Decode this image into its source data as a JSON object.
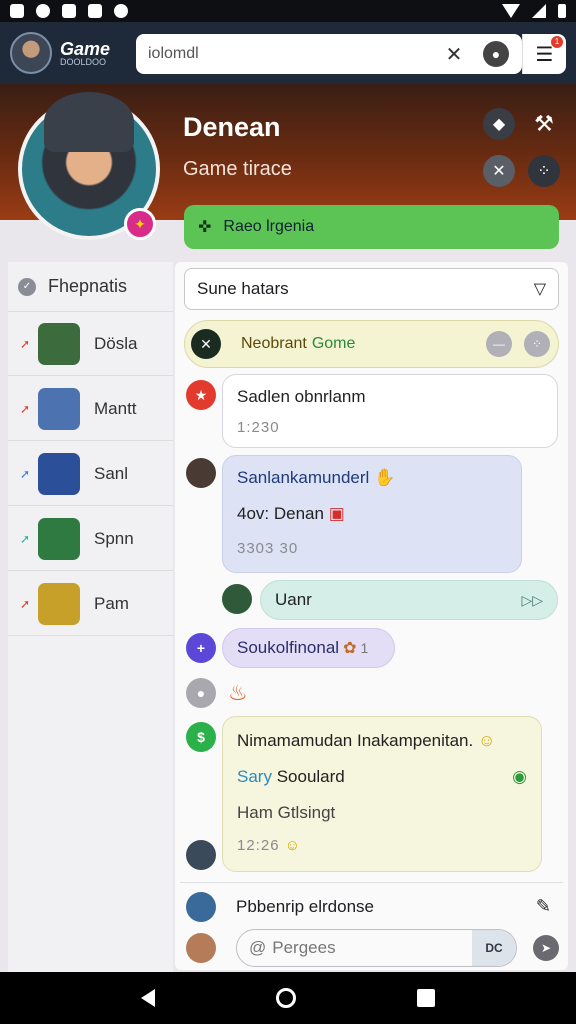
{
  "app": {
    "brand_line1": "Game",
    "brand_line2": "DOOLDOO"
  },
  "search": {
    "text": "iolomdl"
  },
  "menu": {
    "notif_count": "1"
  },
  "profile": {
    "name": "Denean",
    "subtitle": "Game tirace",
    "primary_button": "Raeo lrgenia"
  },
  "sidebar": {
    "header": "Fhepnatis",
    "items": [
      {
        "label": "Dösla",
        "pin_color": "#e23a2c",
        "avatar_color": "#3c6b3e"
      },
      {
        "label": "Mantt",
        "pin_color": "#e23a2c",
        "avatar_color": "#4d72b0"
      },
      {
        "label": "Sanl",
        "pin_color": "#3a78d8",
        "avatar_color": "#2c4f9a"
      },
      {
        "label": "Spnn",
        "pin_color": "#2bb0a0",
        "avatar_color": "#2f7a40"
      },
      {
        "label": "Pam",
        "pin_color": "#e23a2c",
        "avatar_color": "#c7a02a"
      }
    ]
  },
  "filter": {
    "label": "Sune hatars"
  },
  "banner": {
    "text_a": "Neobrant",
    "text_b": "Gome"
  },
  "messages": {
    "m1": {
      "line1": "Sadlen obnrlanm",
      "ts": "1:230"
    },
    "m2": {
      "line1": "Sanlankamunderl",
      "line2": "4ov: Denan",
      "ts": "3303 30"
    },
    "m3": {
      "line1": "Uanr"
    },
    "m4": {
      "line1": "Soukolfinonal",
      "count": "1"
    },
    "m6": {
      "line1": "Nimamamudan Inakampenitan.",
      "line2_a": "Sary",
      "line2_b": "Sooulard",
      "line3": "Ham Gtlsingt",
      "ts": "12:26"
    }
  },
  "composer": {
    "reply_label": "Pbbenrip elrdonse",
    "input_placeholder": "Pergees",
    "input_badge": "DC"
  },
  "colors": {
    "accent_green": "#5cc454",
    "hero_brown": "#6b2c12",
    "appbar": "#1e2a3a"
  },
  "icons": [
    "search-icon",
    "avatar-icon",
    "menu-icon",
    "shield-icon",
    "wrench-icon",
    "sword-icon",
    "grid-icon",
    "send-icon"
  ]
}
